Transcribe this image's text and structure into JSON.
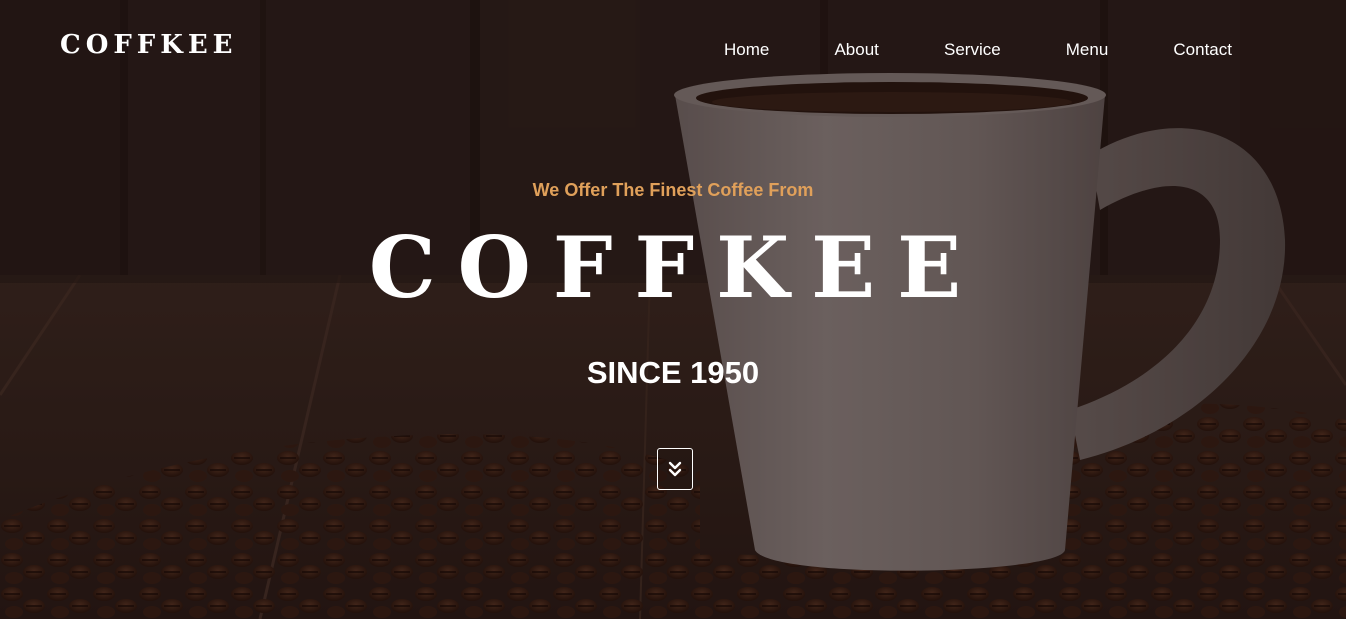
{
  "header": {
    "logo": "COFFKEE",
    "nav": [
      {
        "label": "Home"
      },
      {
        "label": "About"
      },
      {
        "label": "Service"
      },
      {
        "label": "Menu"
      },
      {
        "label": "Contact"
      }
    ]
  },
  "hero": {
    "tagline": "We Offer The Finest Coffee From",
    "brand": "COFFKEE",
    "since": "SINCE 1950",
    "scroll_icon": "double-chevron-down-icon"
  },
  "colors": {
    "accent": "#e0a05a",
    "text": "#ffffff",
    "background": "#2a1c17"
  }
}
